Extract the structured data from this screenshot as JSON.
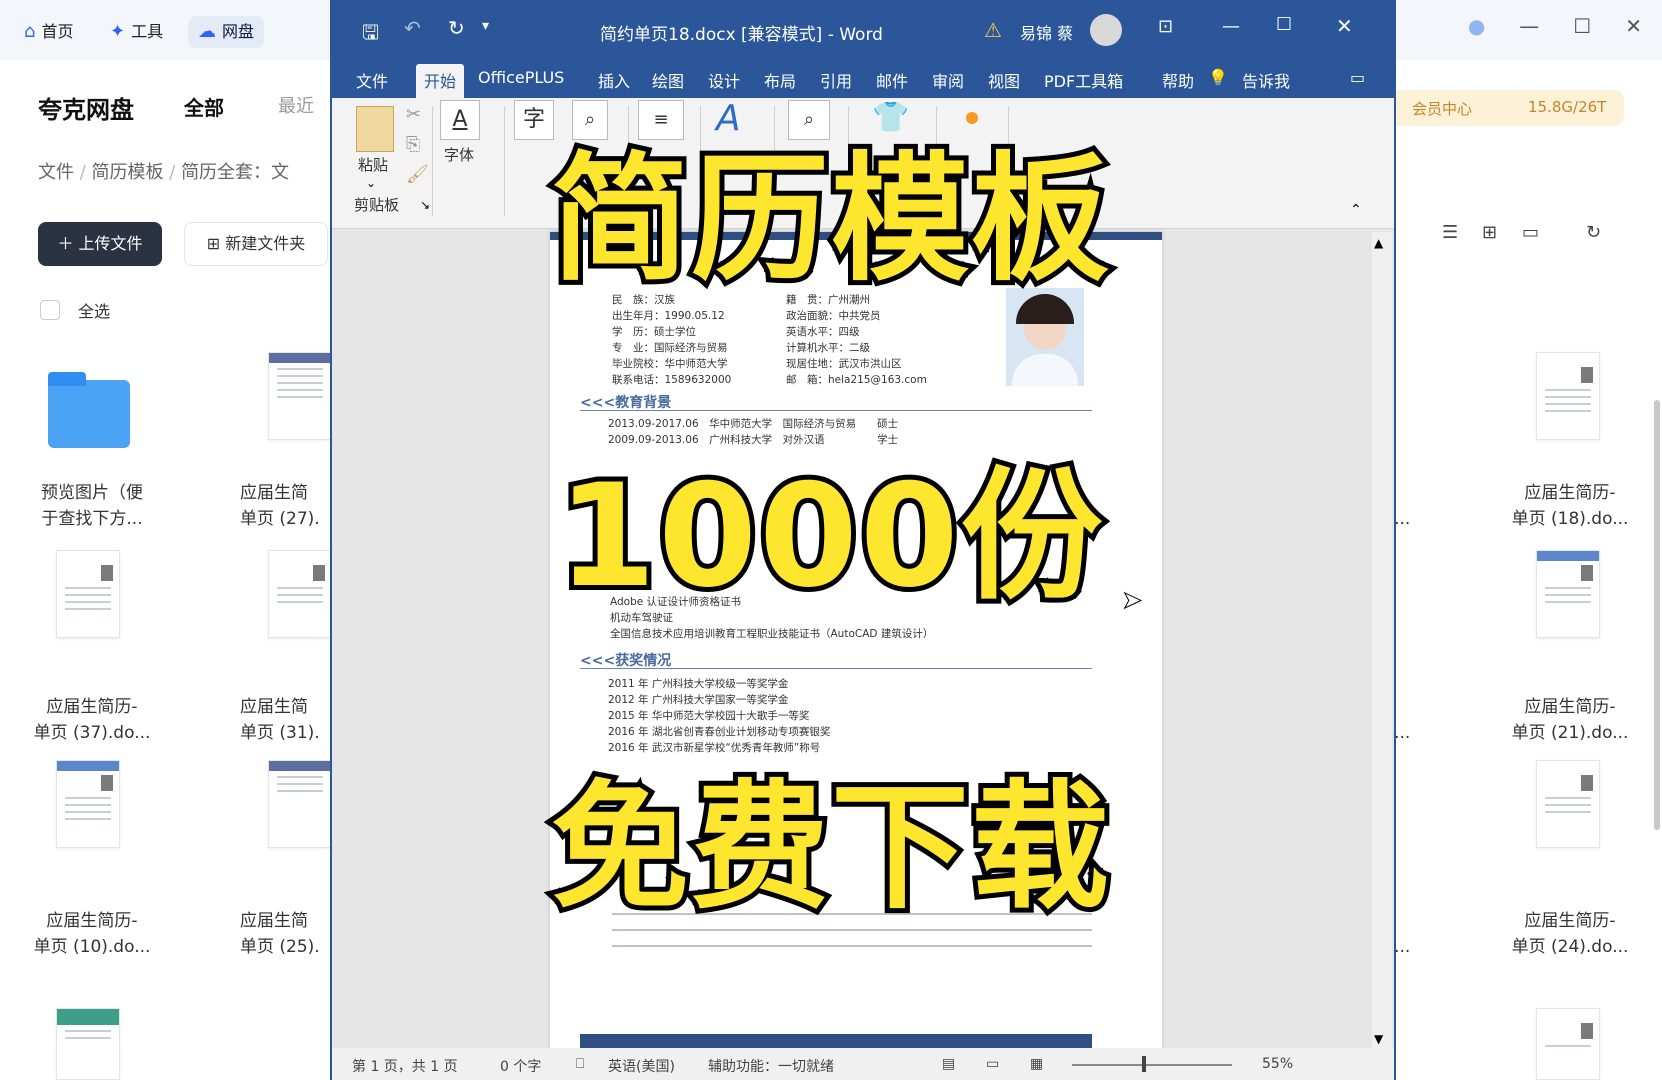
{
  "quark": {
    "tabs": [
      {
        "label": "首页",
        "icon": "home-icon"
      },
      {
        "label": "工具",
        "icon": "sparkle-icon"
      },
      {
        "label": "网盘",
        "icon": "cloud-icon"
      }
    ],
    "brand": "夸克网盘",
    "filter_all": "全部",
    "filter_recent": "最近",
    "breadcrumb": [
      "文件",
      "简历模板",
      "简历全套：文"
    ],
    "upload_button": "上传文件",
    "new_folder_button": "新建文件夹",
    "select_all": "全选",
    "vip_label": "会员中心",
    "storage": "15.8G/26T",
    "left_files": [
      {
        "label": "预览图片（便\n于查找下方..."
      },
      {
        "label": "应届生简\n单页 (27)."
      },
      {
        "label": "应届生简历-\n单页 (37).do..."
      },
      {
        "label": "应届生简\n单页 (31)."
      },
      {
        "label": "应届生简历-\n单页 (10).do..."
      },
      {
        "label": "应届生简\n单页 (25)."
      }
    ],
    "right_files": [
      {
        "label": "应届生简历-\n单页 (18).do..."
      },
      {
        "label": "应届生简历-\n单页 (21).do..."
      },
      {
        "label": "应届生简历-\n单页 (24).do..."
      }
    ],
    "partial_right": [
      "-",
      "o...",
      "-",
      "o...",
      "-",
      "o..."
    ]
  },
  "word": {
    "title": "简约单页18.docx [兼容模式] - Word",
    "user": "易锦 蔡",
    "menu": [
      "文件",
      "开始",
      "OfficePLUS",
      "插入",
      "绘图",
      "设计",
      "布局",
      "引用",
      "邮件",
      "审阅",
      "视图",
      "PDF工具箱",
      "帮助",
      "告诉我"
    ],
    "ribbon": {
      "paste": "粘贴",
      "font": "字体",
      "clipboard": "剪贴板"
    },
    "doc": {
      "info_left": [
        "民　族：汉族",
        "出生年月：1990.05.12",
        "学　历：硕士学位",
        "专　业：国际经济与贸易",
        "毕业院校：华中师范大学",
        "联系电话：1589632000"
      ],
      "info_right": [
        "籍　贯：广州潮州",
        "政治面貌：中共党员",
        "英语水平：四级",
        "计算机水平：二级",
        "现居住地：武汉市洪山区",
        "邮　箱：hela215@163.com"
      ],
      "section_edu": "教育背景",
      "edu": [
        "2013.09-2017.06　华中师范大学　国际经济与贸易　　硕士",
        "2009.09-2013.06　广州科技大学　对外汉语　　　　　学士"
      ],
      "certs": [
        "Adobe 认证设计师资格证书",
        "机动车驾驶证",
        "全国信息技术应用培训教育工程职业技能证书（AutoCAD 建筑设计）"
      ],
      "section_awards": "获奖情况",
      "awards": [
        "2011 年 广州科技大学校级一等奖学金",
        "2012 年 广州科技大学国家一等奖学金",
        "2015 年 华中师范大学校园十大歌手一等奖",
        "2016 年 湖北省创青春创业计划移动专项赛银奖",
        "2016 年 武汉市新星学校“优秀青年教师”称号"
      ]
    },
    "status": {
      "page": "第 1 页，共 1 页",
      "words": "0 个字",
      "lang": "英语(美国)",
      "access": "辅助功能：一切就绪",
      "zoom": "55%"
    }
  },
  "overlay": {
    "line1": "简历模板",
    "line2": "1000份",
    "line3": "免费下载"
  },
  "colors": {
    "word_blue": "#2b579a",
    "caption_yellow": "#ffe62e",
    "quark_dark": "#2b3241"
  }
}
